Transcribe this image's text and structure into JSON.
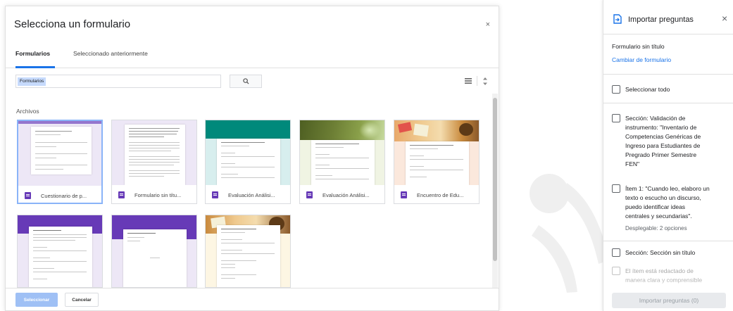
{
  "picker": {
    "title": "Selecciona un formulario",
    "close_glyph": "×",
    "tabs": [
      {
        "label": "Formularios",
        "active": true
      },
      {
        "label": "Seleccionado anteriormente",
        "active": false
      }
    ],
    "search": {
      "chip": "Formularios",
      "icon": "search-icon"
    },
    "view_icons": [
      "list-view-icon",
      "sort-icon"
    ],
    "section_label": "Archivos",
    "files": [
      {
        "name": "Cuestionario de p...",
        "header_color": "#b39ddb",
        "bg_color": "#ede7f6",
        "selected": true,
        "doc_title": "Cuestionario de prueba"
      },
      {
        "name": "Formulario sin títu...",
        "header_color": "#ede7f6",
        "bg_color": "#ede7f6",
        "selected": false,
        "doc_title": "Validación de Instrumento"
      },
      {
        "name": "Evaluación Análisi...",
        "header_color": "#00897b",
        "bg_color": "#d7eeee",
        "selected": false,
        "doc_title": "Evaluación Análisis de Sistemas"
      },
      {
        "name": "Evaluación Análisi...",
        "header_color": "#6d7f35",
        "bg_color": "#f0f4e3",
        "selected": false,
        "doc_title": "Evaluación Análisis de Sistemas"
      },
      {
        "name": "Encuentro de Edu...",
        "header_color": "#d9a14a",
        "bg_color": "#fbe8dc",
        "selected": false,
        "doc_title": "Encuentro de Educación Popular"
      },
      {
        "name": "",
        "header_color": "#673ab7",
        "bg_color": "#ede7f6",
        "selected": false,
        "doc_title": "Encuesta FTPE"
      },
      {
        "name": "",
        "header_color": "#673ab7",
        "bg_color": "#ede7f6",
        "selected": false,
        "doc_title": "Planificación TIC"
      },
      {
        "name": "",
        "header_color": "#d9a14a",
        "bg_color": "#fdf6e3",
        "selected": false,
        "doc_title": "Disponibilidad horaria"
      }
    ],
    "select_button": "Seleccionar",
    "cancel_button": "Cancelar"
  },
  "panel": {
    "icon": "import-file-icon",
    "title": "Importar preguntas",
    "close_glyph": "×",
    "form_name": "Formulario sin título",
    "change_link": "Cambiar de formulario",
    "select_all": "Seleccionar todo",
    "items": [
      {
        "lines": [
          "Sección: Validación de",
          "instrumento: \"Inventario de",
          "Competencias Genéricas de",
          "Ingreso para Estudiantes de",
          "Pregrado Primer Semestre",
          "FEN\""
        ],
        "sub": ""
      },
      {
        "lines": [
          "Ítem 1: \"Cuando leo, elaboro un",
          "texto o escucho un discurso,",
          "puedo identificar ideas",
          "centrales y secundarias\"."
        ],
        "sub": "Desplegable: 2 opciones"
      },
      {
        "lines": [
          "Sección: Sección sin título"
        ],
        "sub": ""
      },
      {
        "lines": [
          "El ítem está redactado de",
          "manera clara y comprensible"
        ],
        "sub": ""
      }
    ],
    "import_button": "Importar preguntas (0)"
  },
  "colors": {
    "accent": "#1a73e8",
    "forms_purple": "#673ab7",
    "selected_border": "#8ab4f8"
  }
}
